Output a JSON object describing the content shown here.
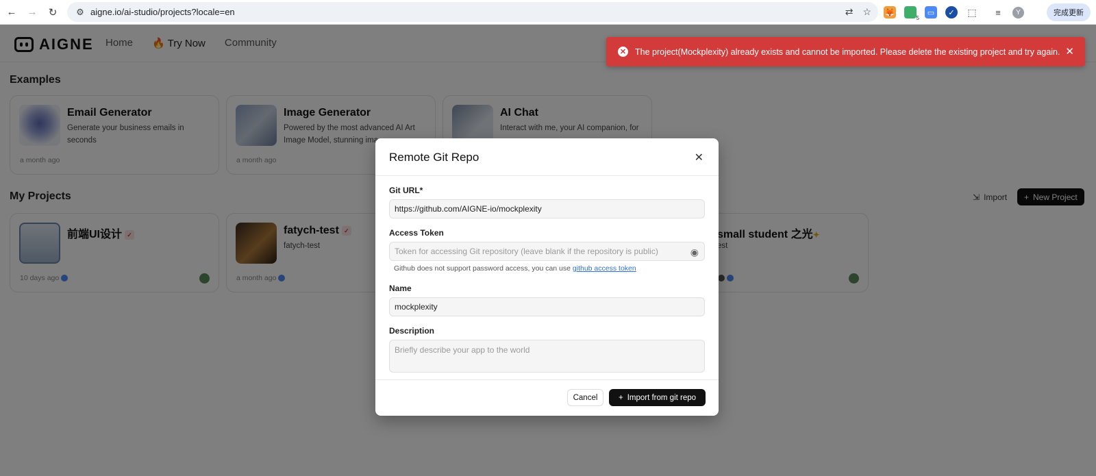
{
  "browser": {
    "url": "aigne.io/ai-studio/projects?locale=en",
    "update_label": "完成更新",
    "profile_initial": "Y",
    "extension_badge": "5"
  },
  "header": {
    "logo_text": "AIGNE",
    "nav": {
      "home": "Home",
      "try_now": "Try Now",
      "community": "Community"
    }
  },
  "examples": {
    "title": "Examples",
    "cards": [
      {
        "title": "Email Generator",
        "desc": "Generate your business emails in seconds",
        "time": "a month ago"
      },
      {
        "title": "Image Generator",
        "desc": "Powered by the most advanced AI Art Image Model, stunning ima",
        "time": "a month ago"
      },
      {
        "title": "AI Chat",
        "desc": "Interact with me, your AI companion, for",
        "time": ""
      }
    ]
  },
  "projects": {
    "title": "My Projects",
    "import_label": "Import",
    "new_label": "New Project",
    "cards": [
      {
        "title": "前端UI设计",
        "time": "10 days ago"
      },
      {
        "title": "fatych-test",
        "desc": "fatych-test",
        "time": "a month ago"
      },
      {
        "title": "small student 之光",
        "desc": "est"
      }
    ]
  },
  "toast": {
    "message": "The project(Mockplexity) already exists and cannot be imported. Please delete the existing project and try again."
  },
  "modal": {
    "title": "Remote Git Repo",
    "git_url": {
      "label": "Git URL*",
      "value": "https://github.com/AIGNE-io/mockplexity"
    },
    "token": {
      "label": "Access Token",
      "placeholder": "Token for accessing Git repository (leave blank if the repository is public)",
      "helper": "Github does not support password access, you can use",
      "helper_link": "github access token"
    },
    "name": {
      "label": "Name",
      "value": "mockplexity"
    },
    "description": {
      "label": "Description",
      "placeholder": "Briefly describe your app to the world"
    },
    "cancel_label": "Cancel",
    "import_label": "Import from git repo"
  }
}
